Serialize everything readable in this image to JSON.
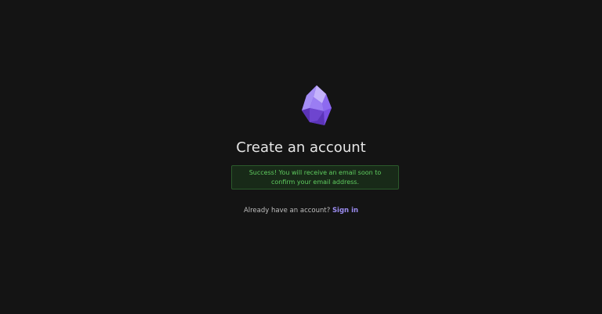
{
  "brand": {
    "logo_icon": "crystal-gem-icon",
    "accent_color": "#8b6cf0"
  },
  "signup": {
    "title": "Create an account",
    "success_message": "Success! You will receive an email soon to confirm your email address.",
    "success_color": "#5fcc5f",
    "footer_prompt": "Already have an account?",
    "sign_in_link": "Sign in"
  }
}
